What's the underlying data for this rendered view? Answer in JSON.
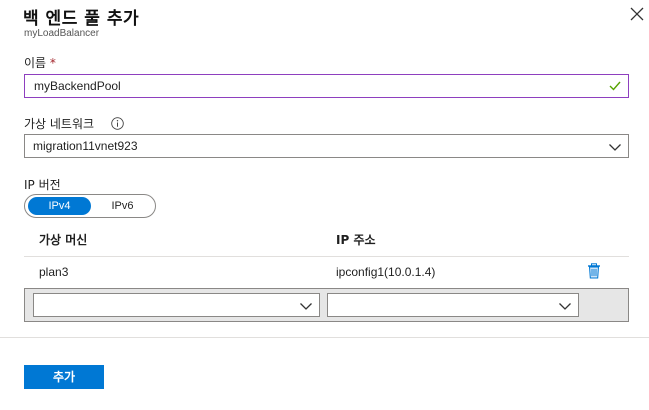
{
  "header": {
    "title": "백 엔드 풀 추가",
    "subtitle": "myLoadBalancer"
  },
  "form": {
    "name_label": "이름",
    "required_mark": "*",
    "name_value": "myBackendPool",
    "vnet_label": "가상 네트워크",
    "vnet_value": "migration11vnet923",
    "ip_version_label": "IP 버전",
    "ip_version_options": [
      "IPv4",
      "IPv6"
    ],
    "ip_version_selected": "IPv4"
  },
  "table": {
    "columns": [
      "가상 머신",
      "IP 주소"
    ],
    "rows": [
      {
        "vm": "plan3",
        "ip": "ipconfig1(10.0.1.4)"
      }
    ],
    "new_row": {
      "vm_value": "",
      "ip_value": ""
    }
  },
  "footer": {
    "add_label": "추가"
  },
  "colors": {
    "accent": "#0078d4",
    "focus_border": "#8e3fbf",
    "valid_check": "#57a300",
    "required": "#a4262c"
  }
}
